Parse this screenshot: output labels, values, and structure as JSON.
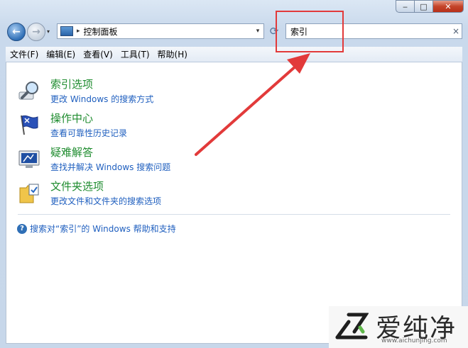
{
  "window": {
    "caption": {
      "minimize": "‒",
      "maximize": "□",
      "close": "✕"
    }
  },
  "nav": {
    "back": "←",
    "forward": "→",
    "breadcrumb_separator": "▸",
    "address": "控制面板",
    "dropdown": "▾",
    "refresh": "⟳",
    "search_value": "索引",
    "search_clear": "×"
  },
  "menu": {
    "file": "文件(F)",
    "edit": "编辑(E)",
    "view": "查看(V)",
    "tools": "工具(T)",
    "help": "帮助(H)"
  },
  "results": [
    {
      "title": "索引选项",
      "desc": "更改 Windows 的搜索方式",
      "icon": "magnifier-icon"
    },
    {
      "title": "操作中心",
      "desc": "查看可靠性历史记录",
      "icon": "flag-icon"
    },
    {
      "title": "疑难解答",
      "desc": "查找并解决 Windows 搜索问题",
      "icon": "troubleshoot-icon"
    },
    {
      "title": "文件夹选项",
      "desc": "更改文件和文件夹的搜索选项",
      "icon": "folder-icon"
    }
  ],
  "help_link": {
    "icon": "?",
    "text": "搜索对“索引”的 Windows 帮助和支持"
  },
  "watermark": {
    "name": "爱纯净",
    "url": "www.aichunjing.com"
  },
  "colors": {
    "annotation": "#e23a3a",
    "result_title": "#1f8c2f",
    "link": "#1f5fbf"
  }
}
